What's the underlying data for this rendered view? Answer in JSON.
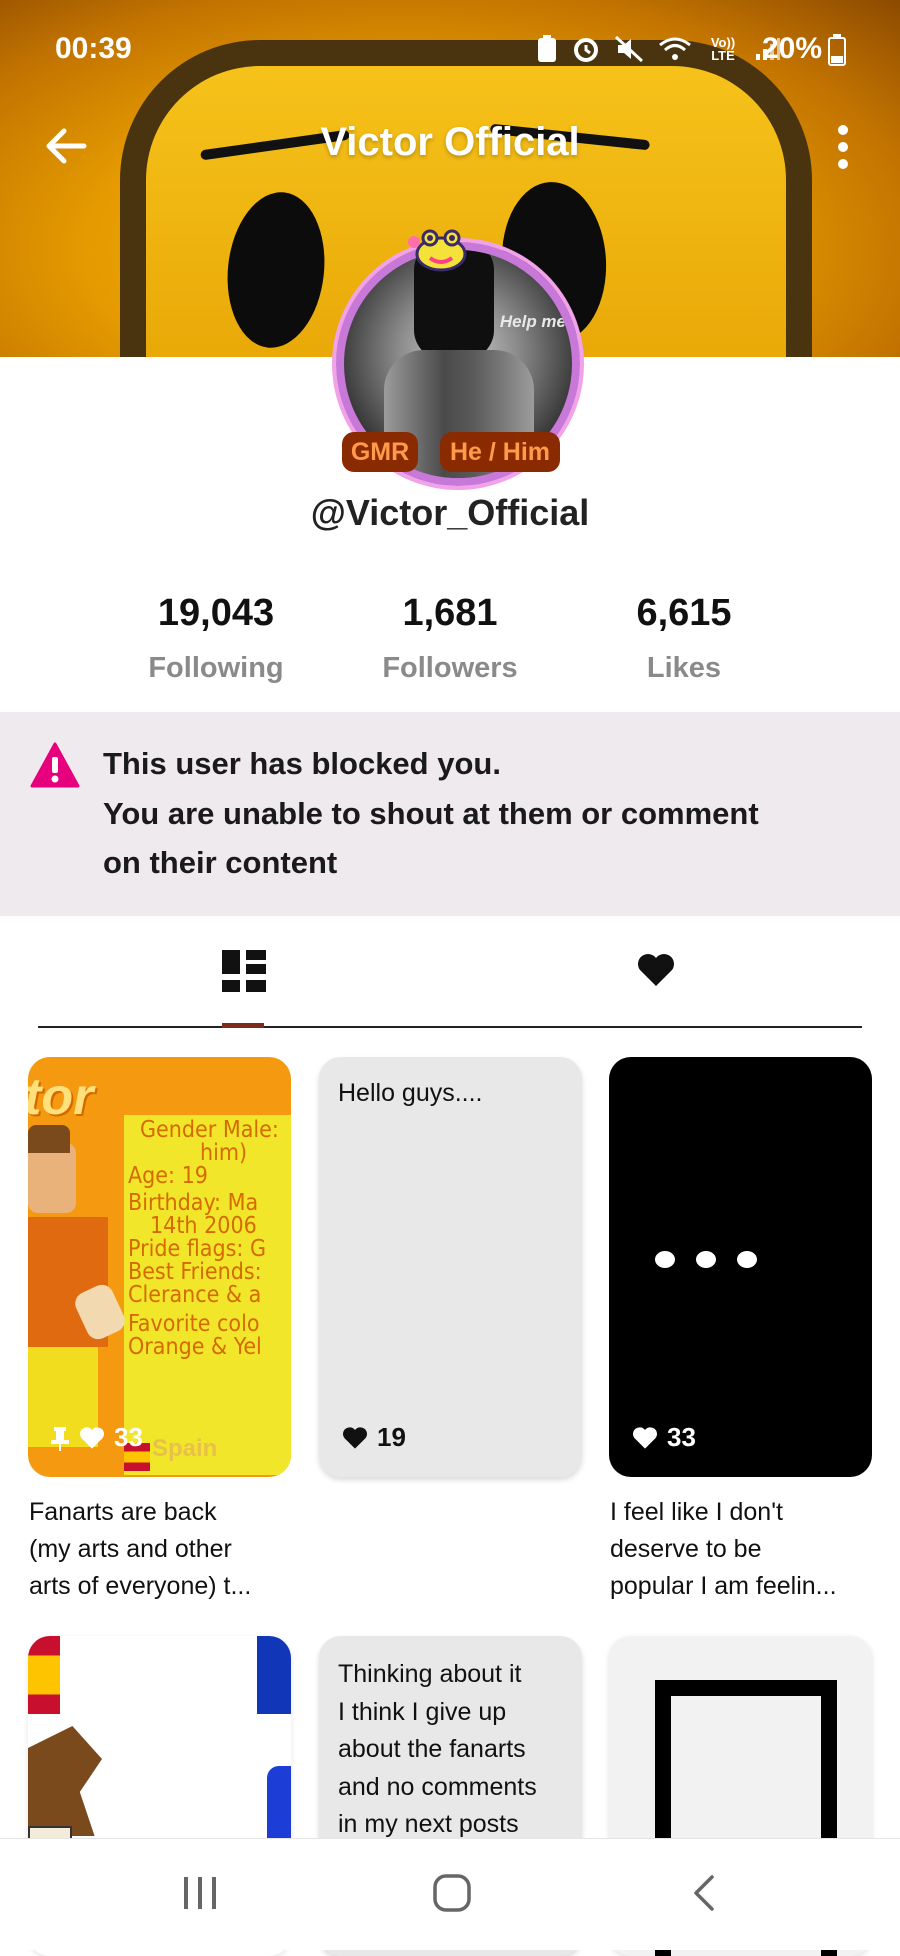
{
  "status_bar": {
    "time": "00:39",
    "battery": "20%",
    "network": "Vo)) LTE"
  },
  "header": {
    "title": "Victor Official",
    "back_icon": "arrow-left-icon",
    "more_icon": "more-vertical-icon"
  },
  "profile": {
    "avatar_caption": "Help me",
    "badges": [
      "GMR",
      "He / Him"
    ],
    "handle": "@Victor_Official"
  },
  "stats": [
    {
      "value": "19,043",
      "label": "Following"
    },
    {
      "value": "1,681",
      "label": "Followers"
    },
    {
      "value": "6,615",
      "label": "Likes"
    }
  ],
  "notice": {
    "line1": "This user has blocked you.",
    "line2": "You are unable to shout at them or comment",
    "line3": "on their content",
    "icon": "warning-icon",
    "color": "#e6007e"
  },
  "tabs": [
    {
      "icon": "grid-icon",
      "active": true
    },
    {
      "icon": "heart-icon",
      "active": false
    }
  ],
  "posts_row1": [
    {
      "likes": "33",
      "caption_l1": "Fanarts are back",
      "caption_l2": "(my arts and other",
      "caption_l3": "arts of everyone) t...",
      "image_text": {
        "title": "tor",
        "lines": [
          "Gender Male:",
          "him)",
          "Age: 19",
          "Birthday: Ma",
          "14th 2006",
          "Pride flags: G",
          "Best Friends:",
          "Clerance & a",
          "Favorite colo",
          "Orange & Yel"
        ],
        "country": "Spain"
      }
    },
    {
      "likes": "19",
      "text": "Hello guys...."
    },
    {
      "likes": "33",
      "caption_l1": "I feel like I don't",
      "caption_l2": "deserve to be",
      "caption_l3": "popular I am feelin..."
    }
  ],
  "posts_row2": [
    {},
    {
      "text_lines": [
        "Thinking about it",
        "I think I give up",
        "about the fanarts",
        "and no comments",
        "in my next posts"
      ]
    },
    {}
  ],
  "nav": {
    "recent_icon": "recents-icon",
    "home_icon": "home-icon",
    "back_icon": "back-icon"
  }
}
